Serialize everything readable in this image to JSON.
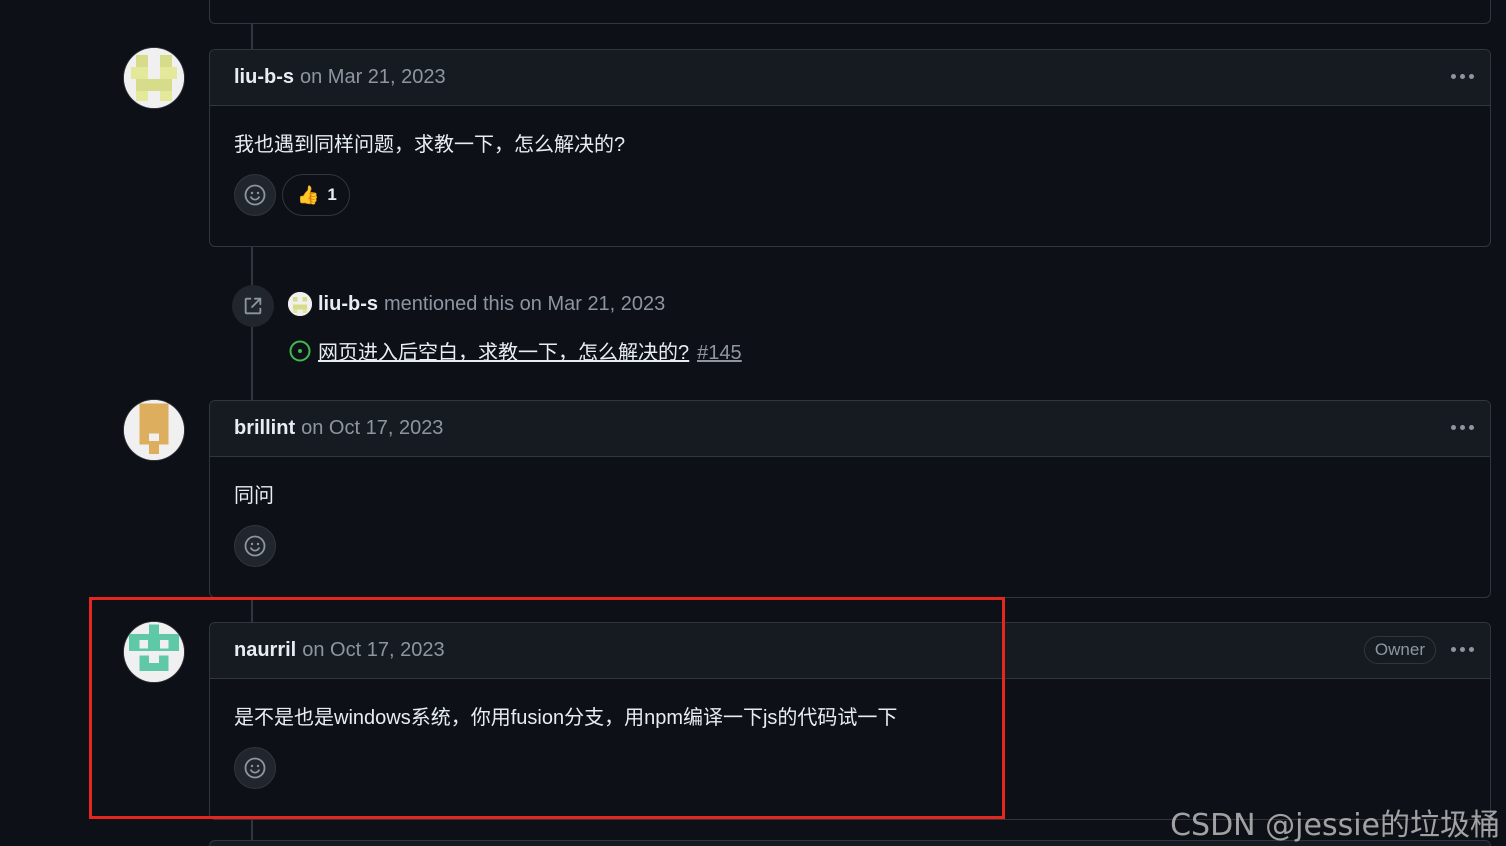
{
  "comments": [
    {
      "author": "liu-b-s",
      "date": "on Mar 21, 2023",
      "body": "我也遇到同样问题，求教一下，怎么解决的?",
      "reaction": {
        "emoji": "👍",
        "count": "1"
      }
    },
    {
      "author": "brillint",
      "date": "on Oct 17, 2023",
      "body": "同问"
    },
    {
      "author": "naurril",
      "date": "on Oct 17, 2023",
      "badge": "Owner",
      "body": "是不是也是windows系统，你用fusion分支，用npm编译一下js的代码试一下"
    }
  ],
  "mention": {
    "author": "liu-b-s",
    "text": "mentioned this on Mar 21, 2023",
    "issue_title": "网页进入后空白，求教一下，怎么解决的?",
    "issue_number": "#145"
  },
  "watermark": "CSDN @jessie的垃圾桶",
  "colors": {
    "background": "#0d1117",
    "header": "#161b22",
    "border": "#30363d",
    "muted": "#8d96a0",
    "open_issue": "#3fb950",
    "highlight": "#e5261f"
  }
}
